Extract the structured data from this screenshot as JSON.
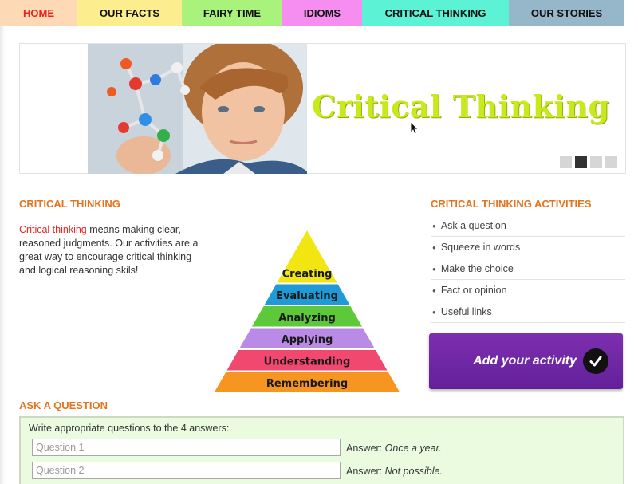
{
  "nav": {
    "home": "HOME",
    "facts": "OUR FACTS",
    "fairy": "FAIRY TIME",
    "idioms": "IDIOMS",
    "critical": "CRITICAL THINKING",
    "stories": "OUR STORIES"
  },
  "banner": {
    "title": "Critical Thinking",
    "slides": 4,
    "active_slide": 2
  },
  "critical_section": {
    "heading": "CRITICAL THINKING",
    "intro_highlight": "Critical thinking",
    "intro_rest": " means making clear, reasoned judgments. Our activities are a great way to encourage critical thinking and logical reasoning skils!"
  },
  "pyramid": {
    "levels": [
      "Creating",
      "Evaluating",
      "Analyzing",
      "Applying",
      "Understanding",
      "Remembering"
    ],
    "colors": [
      "#f2e612",
      "#1f9ad6",
      "#5cc83a",
      "#b98ae6",
      "#f0486e",
      "#f6951f"
    ]
  },
  "activities": {
    "heading": "CRITICAL THINKING ACTIVITIES",
    "items": [
      "Ask a question",
      "Squeeze in words",
      "Make the choice",
      "Fact or opinion",
      "Useful links"
    ],
    "add_button": "Add your activity"
  },
  "ask": {
    "heading": "ASK A QUESTION",
    "instructions": "Write appropriate questions to the 4 answers:",
    "questions": [
      {
        "placeholder": "Question 1",
        "answer_label": "Answer:",
        "answer": "Once a year."
      },
      {
        "placeholder": "Question 2",
        "answer_label": "Answer:",
        "answer": "Not possible."
      }
    ]
  }
}
